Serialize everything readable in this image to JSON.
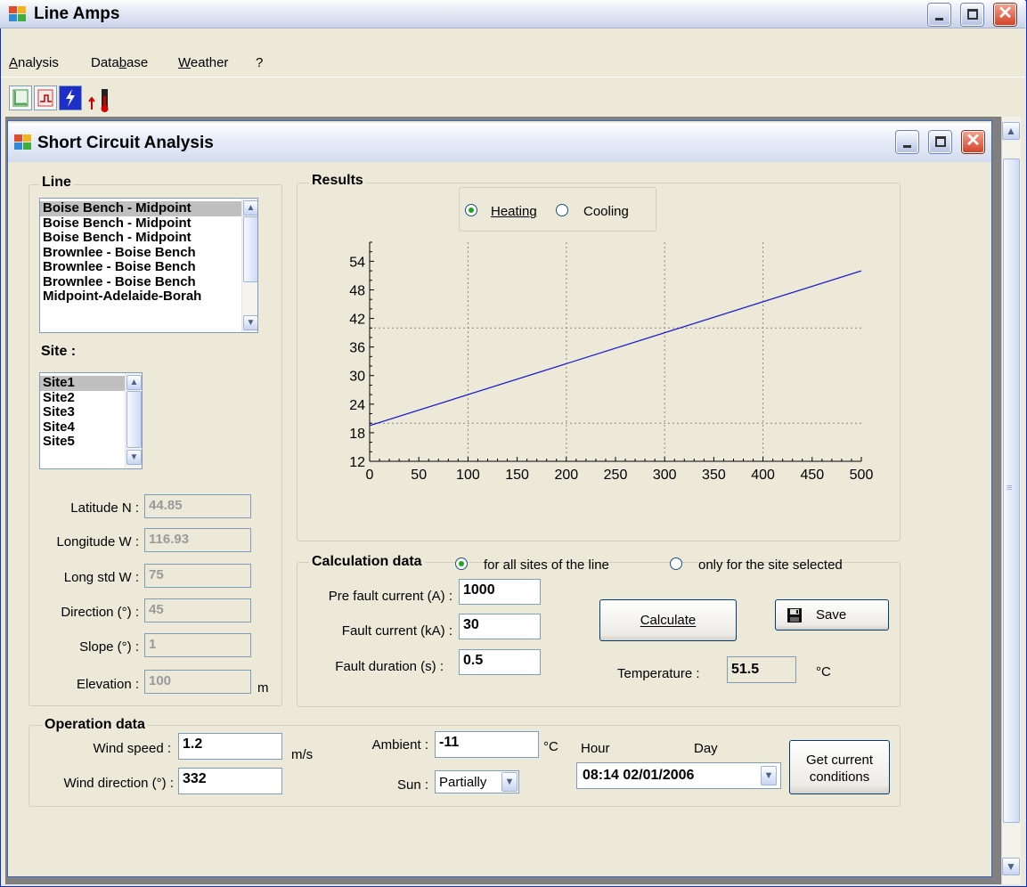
{
  "app": {
    "title": "Line Amps"
  },
  "menu": {
    "items": [
      {
        "id": "analysis",
        "label": "Analysis"
      },
      {
        "id": "database",
        "label": "Database"
      },
      {
        "id": "weather",
        "label": "Weather"
      },
      {
        "id": "help",
        "label": "?"
      }
    ]
  },
  "toolbar": {
    "icons": [
      "line-chart-icon",
      "step-chart-icon",
      "lightning-icon",
      "thermometer-icon"
    ]
  },
  "child": {
    "title": "Short Circuit Analysis"
  },
  "line": {
    "group_title": "Line",
    "items": [
      "Boise Bench - Midpoint",
      "Boise Bench - Midpoint",
      "Boise Bench - Midpoint",
      "Brownlee - Boise Bench",
      "Brownlee - Boise Bench",
      "Brownlee - Boise Bench",
      "Midpoint-Adelaide-Borah"
    ],
    "selected_index": 0
  },
  "site": {
    "label": "Site :",
    "items": [
      "Site1",
      "Site2",
      "Site3",
      "Site4",
      "Site5"
    ],
    "selected_index": 0
  },
  "geo": {
    "latitude_label": "Latitude N :",
    "latitude": "44.85",
    "longitude_label": "Longitude W :",
    "longitude": "116.93",
    "longstd_label": "Long std W :",
    "longstd": "75",
    "direction_label": "Direction (°) :",
    "direction": "45",
    "slope_label": "Slope (°) :",
    "slope": "1",
    "elevation_label": "Elevation :",
    "elevation": "100",
    "elevation_unit": "m"
  },
  "results": {
    "group_title": "Results",
    "heating_label": "Heating",
    "cooling_label": "Cooling",
    "selected": "heating"
  },
  "chart_data": {
    "type": "line",
    "x": [
      0,
      500
    ],
    "series": [
      {
        "values": [
          19.5,
          52
        ]
      }
    ],
    "xlim": [
      0,
      500
    ],
    "ylim": [
      12,
      58
    ],
    "xticks": [
      0,
      50,
      100,
      150,
      200,
      250,
      300,
      350,
      400,
      450,
      500
    ],
    "yticks": [
      12,
      18,
      24,
      30,
      36,
      42,
      48,
      54
    ],
    "grid_x": [
      100,
      200,
      300,
      400
    ],
    "grid_y": [
      20,
      40
    ],
    "line_color": "#2020c8"
  },
  "calc": {
    "group_title": "Calculation data",
    "opt_all_label": "for all sites of the line",
    "opt_selected_label": "only for the site selected",
    "selected": "all",
    "prefault_label": "Pre fault current (A) :",
    "prefault": "1000",
    "fault_label": "Fault current (kA) :",
    "fault": "30",
    "duration_label": "Fault duration (s) :",
    "duration": "0.5",
    "calculate_label": "Calculate",
    "save_label": "Save",
    "temperature_label": "Temperature :",
    "temperature": "51.5",
    "temperature_unit": "°C"
  },
  "op": {
    "group_title": "Operation data",
    "wind_speed_label": "Wind speed :",
    "wind_speed": "1.2",
    "wind_speed_unit": "m/s",
    "wind_dir_label": "Wind direction (°) :",
    "wind_dir": "332",
    "ambient_label": "Ambient :",
    "ambient": "-11",
    "ambient_unit": "°C",
    "sun_label": "Sun :",
    "sun": "Partially",
    "hour_label": "Hour",
    "day_label": "Day",
    "datetime": "08:14 02/01/2006",
    "get_conditions_label": "Get current conditions"
  }
}
